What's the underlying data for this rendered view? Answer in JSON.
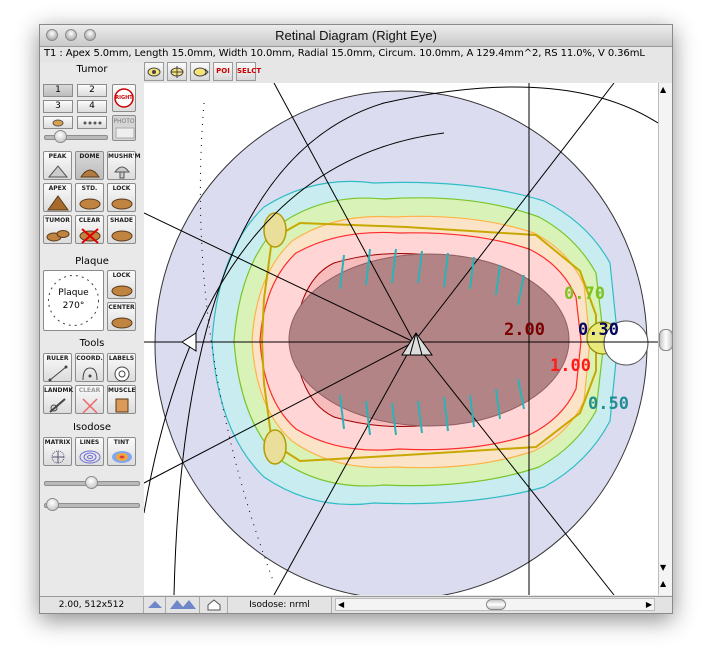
{
  "window": {
    "title": "Retinal Diagram (Right Eye)"
  },
  "info": {
    "text": "T1 : Apex 5.0mm, Length 15.0mm, Width 10.0mm, Radial 15.0mm, Circum. 10.0mm, A 129.4mm^2, RS 11.0%, V 0.36mL"
  },
  "toolbar": {
    "items": [
      "",
      "",
      "",
      "POI",
      "SELCT"
    ]
  },
  "tumor": {
    "heading": "Tumor",
    "numbers": [
      "1",
      "2",
      "3",
      "4"
    ],
    "right_label": "RIGHT",
    "photo_label": "PHOTO",
    "shapes": [
      {
        "label": "PEAK"
      },
      {
        "label": "DOME"
      },
      {
        "label": "MUSHR'M"
      },
      {
        "label": "APEX"
      },
      {
        "label": "STD."
      },
      {
        "label": "LOCK"
      },
      {
        "label": "TUMOR"
      },
      {
        "label": "CLEAR"
      },
      {
        "label": "SHADE"
      }
    ]
  },
  "plaque": {
    "heading": "Plaque",
    "dial_label": "Plaque",
    "angle": "270°",
    "lock_label": "LOCK",
    "center_label": "CENTER"
  },
  "tools": {
    "heading": "Tools",
    "buttons": [
      {
        "label": "RULER"
      },
      {
        "label": "COORD."
      },
      {
        "label": "LABELS"
      },
      {
        "label": "LANDMK"
      },
      {
        "label": "CLEAR"
      },
      {
        "label": "MUSCLE"
      }
    ]
  },
  "isodose": {
    "heading": "Isodose",
    "buttons": [
      {
        "label": "MATRIX"
      },
      {
        "label": "LINES"
      },
      {
        "label": "TINT"
      }
    ]
  },
  "diagram": {
    "isodose_labels": [
      {
        "text": "0.70",
        "color": "#7fc31c"
      },
      {
        "text": "2.00",
        "color": "#7a0000"
      },
      {
        "text": "0.30",
        "color": "#06065e"
      },
      {
        "text": "1.00",
        "color": "#ff1a1a"
      },
      {
        "text": "0.50",
        "color": "#1f8f93"
      }
    ]
  },
  "statusbar": {
    "zoom": "2.00, 512x512",
    "isodose": "Isodose: nrml"
  }
}
